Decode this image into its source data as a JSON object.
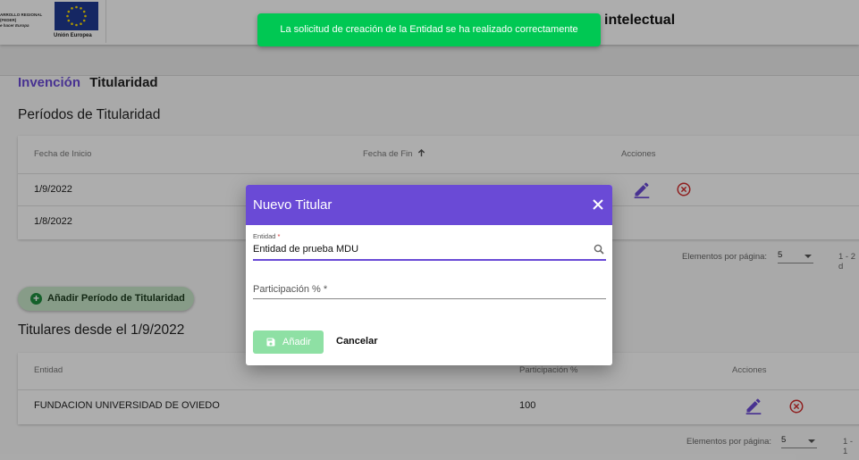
{
  "header": {
    "logo_text_line1": "ARROLLO REGIONAL (FEDER)",
    "logo_text_line2": "e hacer Europa",
    "eu_label": "Unión Europea",
    "title_fragment": "intelectual"
  },
  "breadcrumb": {
    "item1": "Invención",
    "item2": "Titularidad"
  },
  "periods": {
    "title": "Períodos de Titularidad",
    "columns": [
      "Fecha de Inicio",
      "Fecha de Fin",
      "Acciones"
    ],
    "rows": [
      {
        "start": "1/9/2022"
      },
      {
        "start": "1/8/2022"
      }
    ],
    "pager_label": "Elementos por página:",
    "pager_value": "5",
    "pager_range": "1 - 2 d"
  },
  "add_period_button": "Añadir Período de Titularidad",
  "holders": {
    "title": "Titulares desde el 1/9/2022",
    "columns": [
      "Entidad",
      "Participación %",
      "Acciones"
    ],
    "rows": [
      {
        "entity": "FUNDACION UNIVERSIDAD DE OVIEDO",
        "participation": "100"
      }
    ],
    "pager_label": "Elementos por página:",
    "pager_value": "5",
    "pager_range": "1 - 1"
  },
  "toast": {
    "message": "La solicitud de creación de la Entidad se ha realizado correctamente"
  },
  "dialog": {
    "title": "Nuevo Titular",
    "entity_label": "Entidad",
    "required_mark": "*",
    "entity_value": "Entidad de prueba MDU",
    "participation_placeholder": "Participación % *",
    "add_button": "Añadir",
    "cancel_button": "Cancelar"
  },
  "colors": {
    "primary": "#6a4ad6",
    "toast_green": "#00c853",
    "delete_red": "#d32f2f",
    "add_disabled": "#8ee0a4"
  },
  "icons": [
    "close-icon",
    "search-icon",
    "save-icon",
    "edit-icon",
    "cancel-circle-icon",
    "plus-icon",
    "arrow-up-icon",
    "chevron-down-icon"
  ]
}
